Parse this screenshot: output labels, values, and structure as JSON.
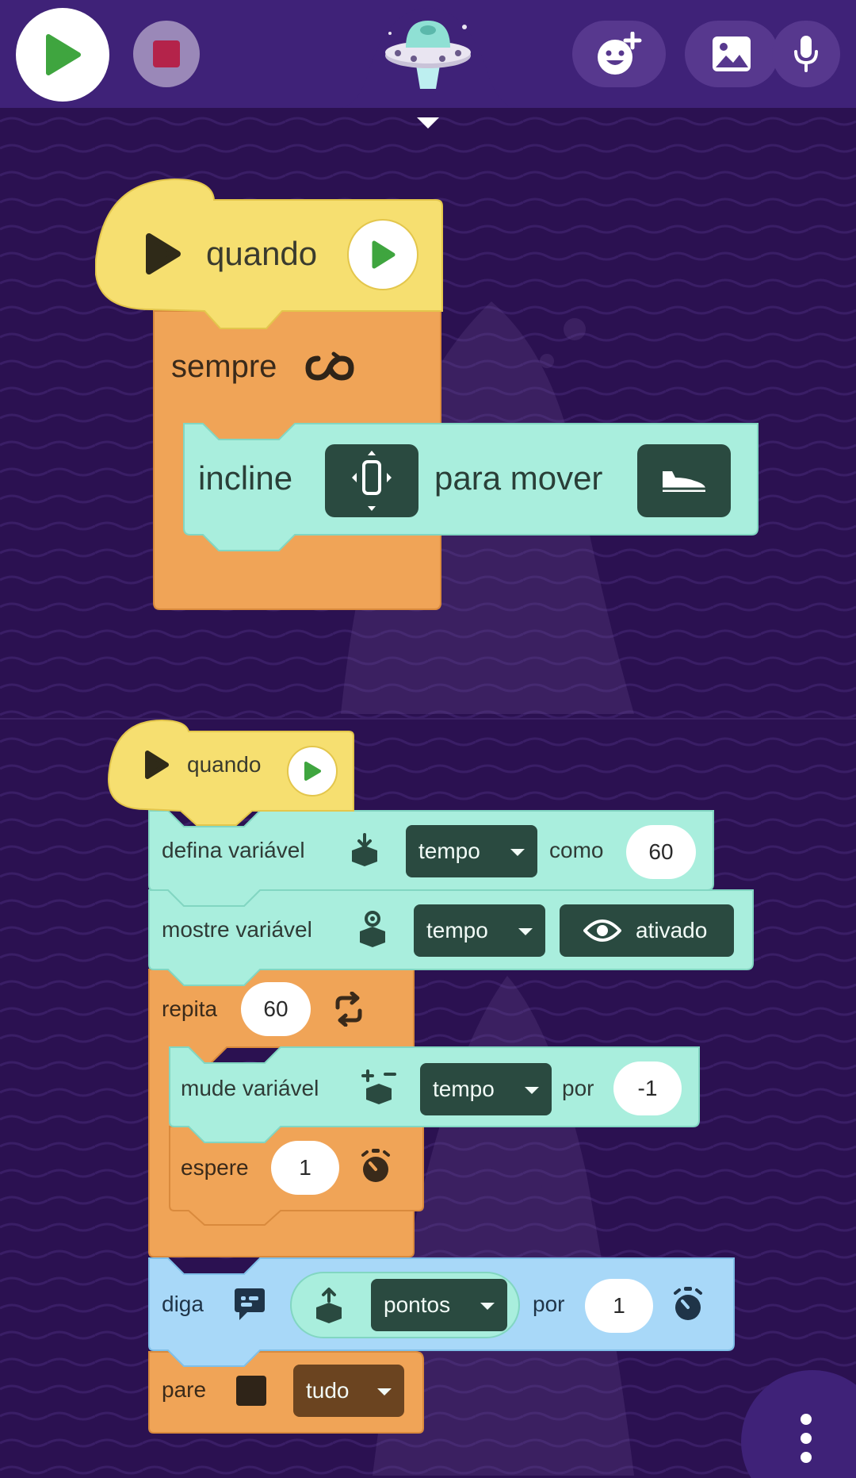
{
  "toolbar": {
    "play_icon": "play-icon",
    "stop_icon": "stop-icon",
    "mascot_icon": "ufo-mascot-icon",
    "add_sticker_icon": "add-emoji-icon",
    "image_icon": "image-icon",
    "mic_icon": "microphone-icon",
    "collapse_icon": "chevron-down-icon"
  },
  "script1": {
    "hat_label": "quando",
    "forever_label": "sempre",
    "forever_icon": "infinity-loop-icon",
    "tilt_label": "incline",
    "tilt_icon": "phone-tilt-icon",
    "tilt_suffix": "para mover",
    "shoe_icon": "shoe-icon"
  },
  "script2": {
    "hat_label": "quando",
    "set_var": {
      "label": "defina variável",
      "icon": "variable-set-icon",
      "variable": "tempo",
      "as_label": "como",
      "value": "60"
    },
    "show_var": {
      "label": "mostre variável",
      "icon": "variable-show-icon",
      "variable": "tempo",
      "toggle_icon": "eye-icon",
      "toggle_label": "ativado"
    },
    "repeat": {
      "label": "repita",
      "count": "60",
      "icon": "repeat-icon"
    },
    "change_var": {
      "label": "mude variável",
      "icon": "variable-change-icon",
      "variable": "tempo",
      "by_label": "por",
      "value": "-1"
    },
    "wait": {
      "label": "espere",
      "value": "1",
      "icon": "stopwatch-icon"
    },
    "say": {
      "label": "diga",
      "icon": "speech-bubble-icon",
      "reporter_icon": "variable-get-icon",
      "variable": "pontos",
      "for_label": "por",
      "value": "1",
      "timer_icon": "stopwatch-icon"
    },
    "stop": {
      "label": "pare",
      "icon": "stop-square-icon",
      "option": "tudo"
    }
  },
  "more_menu_icon": "more-vertical-icon",
  "colors": {
    "background": "#2b1151",
    "topbar": "#3f2278",
    "event_block": "#f6df70",
    "control_block": "#f0a457",
    "motion_block": "#a9eedd",
    "looks_block": "#a8d8f8",
    "dropdown": "#2a4a40",
    "play_green": "#3fa53f",
    "stop_red": "#b4234a"
  }
}
